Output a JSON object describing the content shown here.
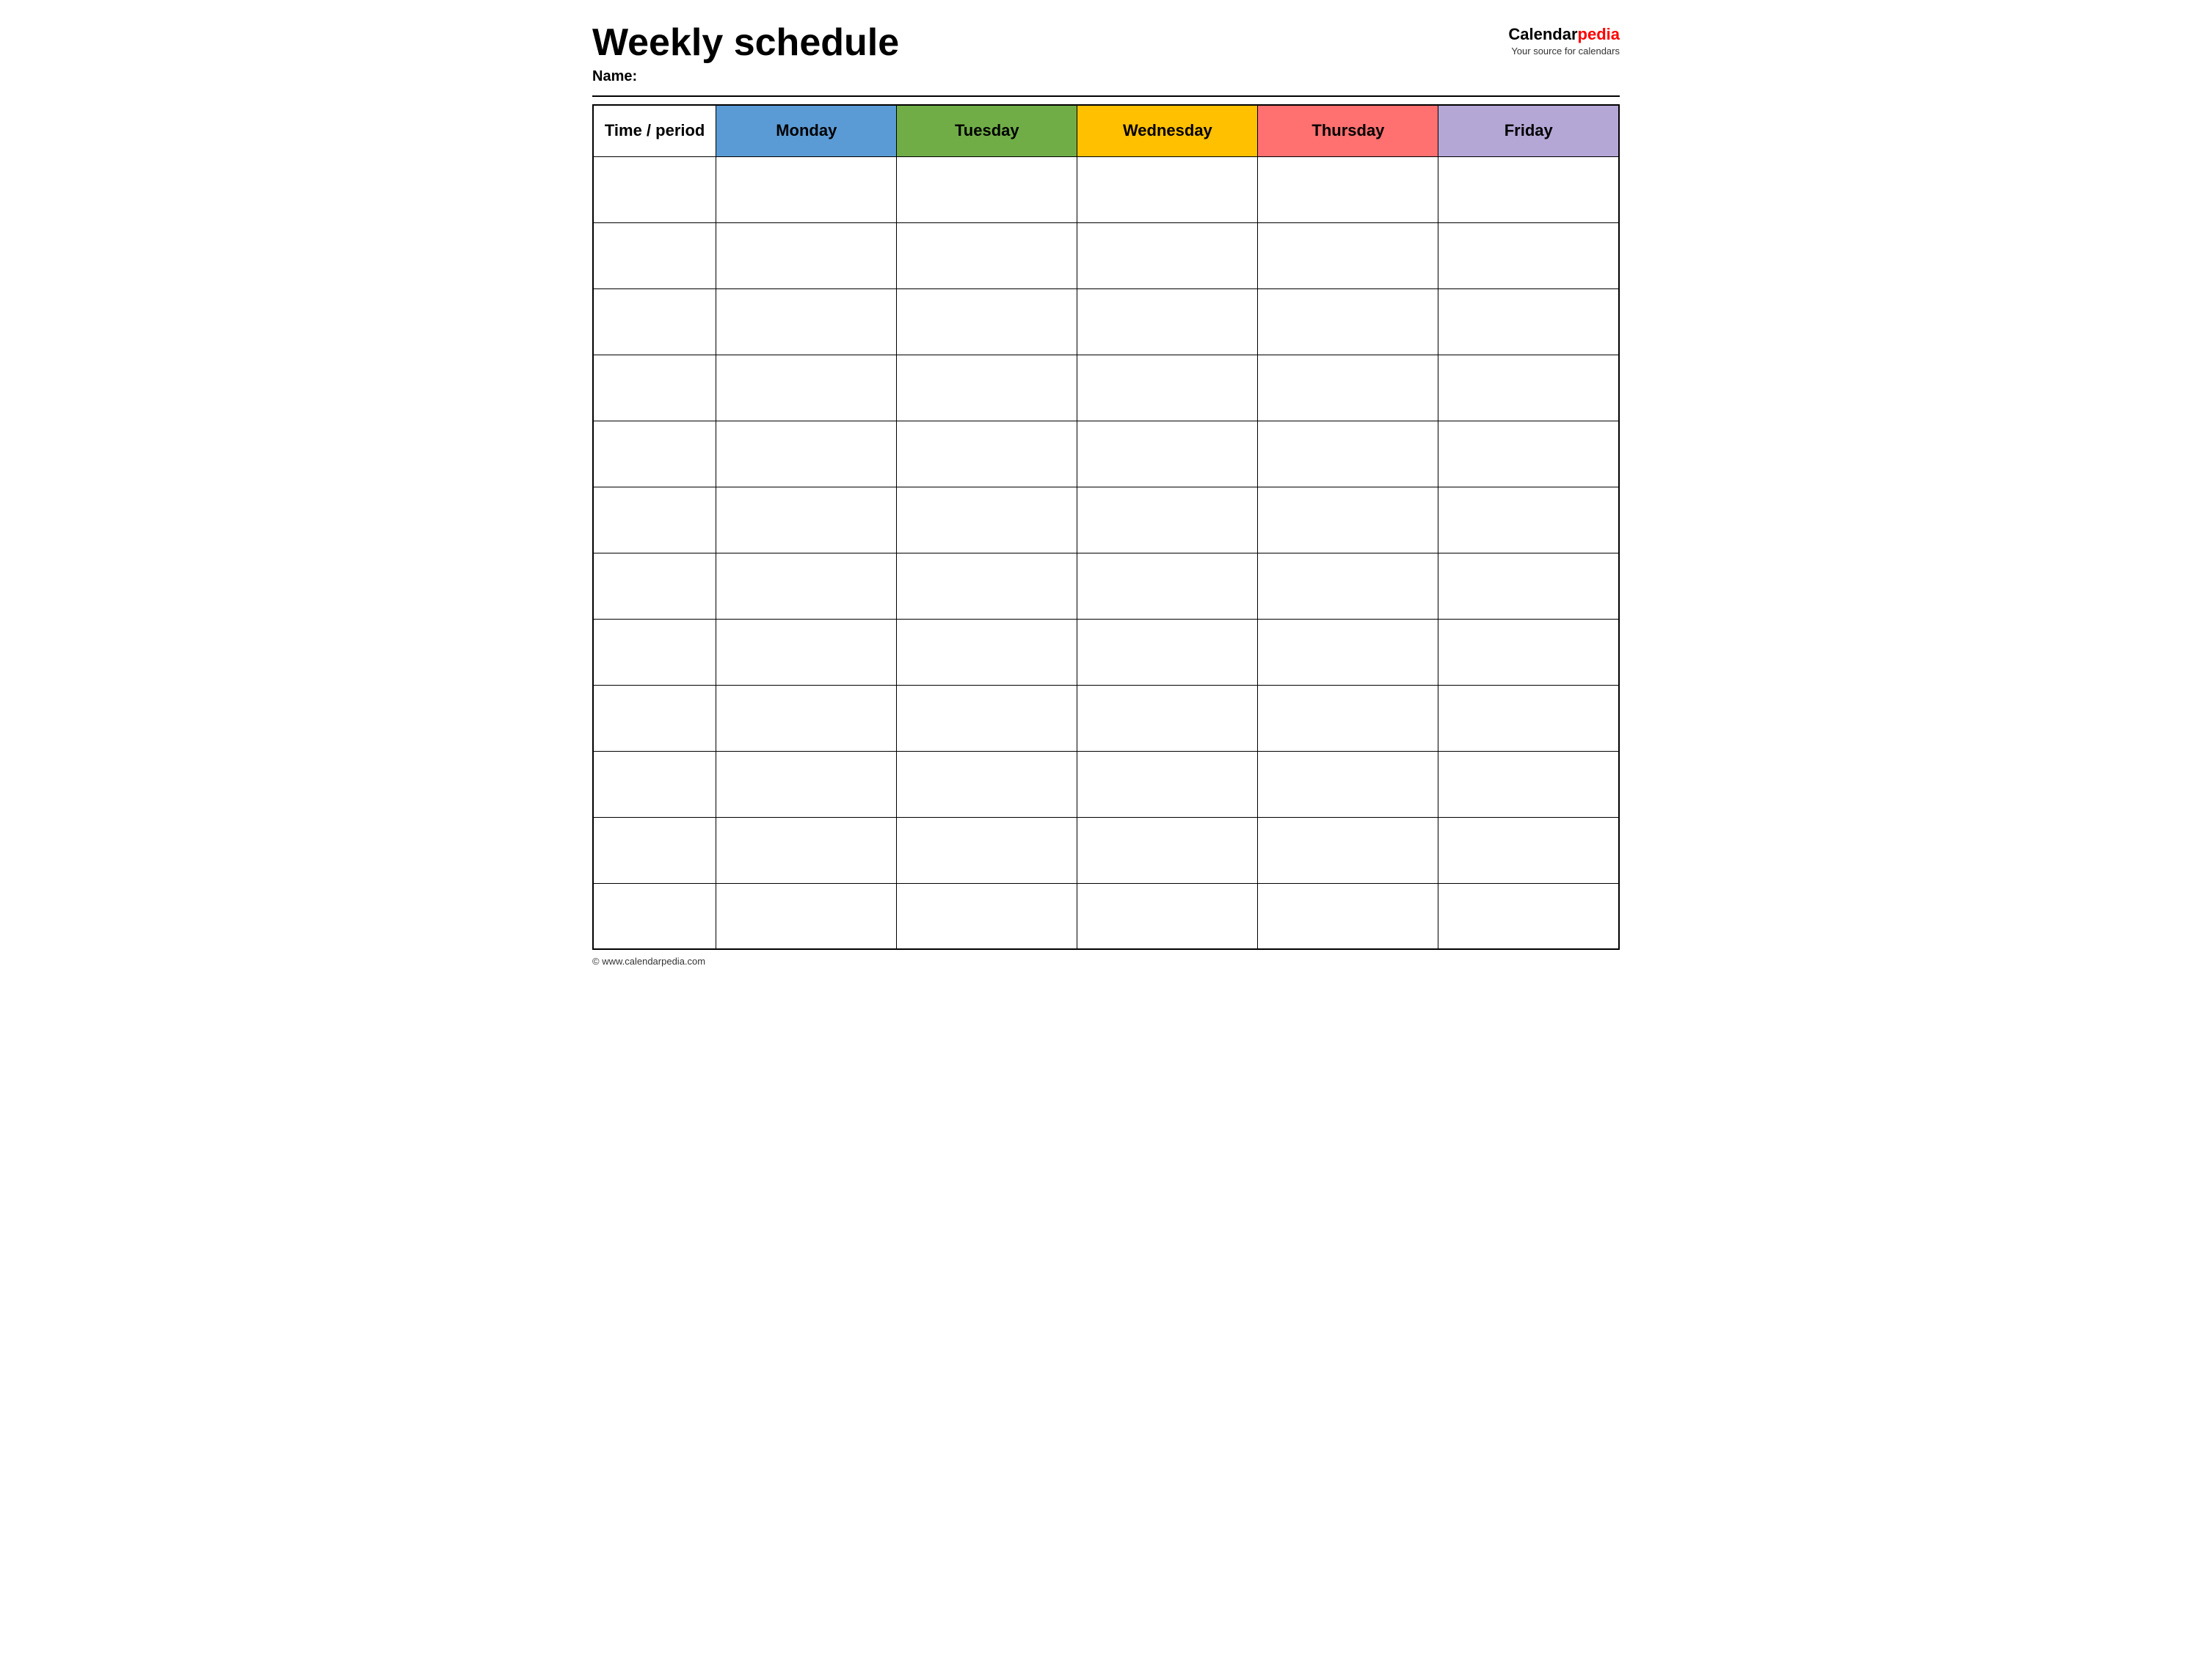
{
  "header": {
    "title": "Weekly schedule",
    "name_label": "Name:",
    "logo_calendar": "Calendar",
    "logo_pedia": "pedia",
    "logo_tagline": "Your source for calendars"
  },
  "table": {
    "columns": [
      {
        "id": "time",
        "label": "Time / period",
        "color": "#ffffff"
      },
      {
        "id": "monday",
        "label": "Monday",
        "color": "#5b9bd5"
      },
      {
        "id": "tuesday",
        "label": "Tuesday",
        "color": "#70ad47"
      },
      {
        "id": "wednesday",
        "label": "Wednesday",
        "color": "#ffc000"
      },
      {
        "id": "thursday",
        "label": "Thursday",
        "color": "#ff7070"
      },
      {
        "id": "friday",
        "label": "Friday",
        "color": "#b4a7d6"
      }
    ],
    "row_count": 12
  },
  "footer": {
    "url": "© www.calendarpedia.com"
  }
}
